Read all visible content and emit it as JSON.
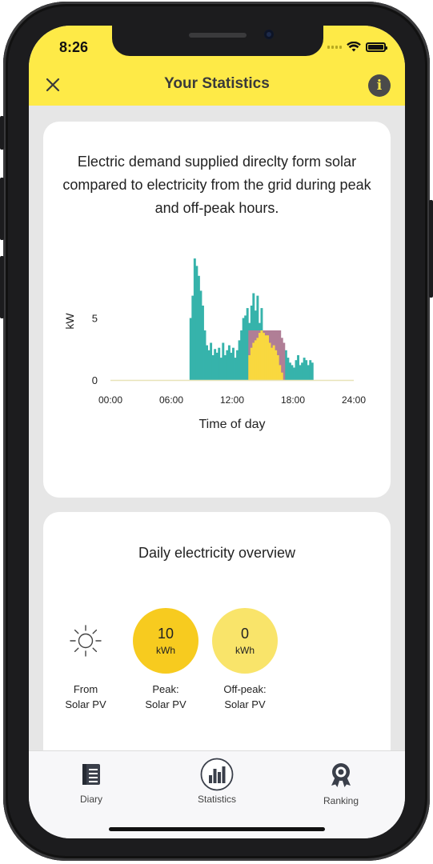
{
  "status_bar": {
    "time": "8:26"
  },
  "header": {
    "title": "Your Statistics",
    "close_icon": "close-icon",
    "info_label": "i"
  },
  "chart_card": {
    "description": "Electric demand supplied direclty form solar compared to electricity from the grid during peak and off-peak hours."
  },
  "chart_data": {
    "type": "area",
    "xlabel": "Time of day",
    "ylabel": "kW",
    "x_ticks": [
      "00:00",
      "06:00",
      "12:00",
      "18:00",
      "24:00"
    ],
    "y_ticks": [
      "0",
      "5"
    ],
    "xlim": [
      0,
      24
    ],
    "ylim": [
      0,
      10
    ],
    "colors": {
      "demand": "#36b3ab",
      "grid": "#b07e96",
      "solar": "#f9d83f",
      "baseline": "#e8e3b8"
    },
    "series": [
      {
        "key": "demand",
        "hours": [
          7.8,
          8.0,
          8.2,
          8.4,
          8.6,
          8.8,
          9.0,
          9.2,
          9.4,
          9.6,
          9.8,
          10.0,
          10.2,
          10.4,
          10.6,
          10.8,
          11.0,
          11.2,
          11.4,
          11.6,
          11.8,
          12.0,
          12.2,
          12.4,
          12.6,
          12.8,
          13.0,
          13.2,
          13.4,
          13.6,
          13.8,
          14.0,
          14.2,
          14.4,
          14.6,
          14.8,
          15.0,
          15.2,
          15.4,
          15.6,
          15.8,
          16.0,
          16.2,
          16.4,
          16.6,
          16.8,
          17.0,
          17.2,
          17.4,
          17.6,
          17.8,
          18.0,
          18.2,
          18.4,
          18.6,
          18.8,
          19.0,
          19.2,
          19.4,
          19.6,
          19.8
        ],
        "values": [
          5.0,
          6.8,
          9.8,
          9.2,
          8.4,
          7.2,
          6.0,
          4.0,
          2.8,
          2.4,
          3.0,
          2.0,
          2.5,
          2.2,
          2.6,
          1.8,
          3.0,
          2.0,
          2.4,
          2.8,
          2.2,
          2.6,
          1.8,
          2.4,
          3.2,
          4.0,
          5.0,
          5.2,
          5.8,
          4.6,
          6.0,
          7.0,
          5.6,
          6.8,
          4.6,
          5.8,
          4.0,
          3.6,
          3.8,
          4.0,
          3.2,
          3.0,
          2.8,
          2.2,
          1.4,
          1.0,
          1.8,
          2.4,
          1.8,
          1.4,
          1.2,
          1.0,
          1.6,
          2.0,
          1.2,
          1.4,
          1.8,
          1.6,
          1.2,
          1.6,
          1.4
        ]
      },
      {
        "key": "grid",
        "hours": [
          13.6,
          13.8,
          14.0,
          14.2,
          14.4,
          14.6,
          14.8,
          15.0,
          15.2,
          15.4,
          15.6,
          15.8,
          16.0,
          16.2,
          16.4,
          16.6,
          16.8,
          17.0
        ],
        "values": [
          4.0,
          4.0,
          4.0,
          4.0,
          4.0,
          4.0,
          4.0,
          4.0,
          4.0,
          4.0,
          4.0,
          4.0,
          4.0,
          4.0,
          4.0,
          4.0,
          3.4,
          3.0
        ]
      },
      {
        "key": "solar",
        "hours": [
          13.6,
          13.8,
          14.0,
          14.2,
          14.4,
          14.6,
          14.8,
          15.0,
          15.2,
          15.4,
          15.6,
          15.8,
          16.0,
          16.2,
          16.4,
          16.6,
          16.8
        ],
        "values": [
          2.0,
          2.6,
          3.0,
          3.2,
          3.4,
          3.8,
          4.0,
          3.8,
          3.6,
          3.6,
          3.0,
          2.6,
          2.8,
          2.4,
          2.0,
          1.2,
          0.6
        ]
      }
    ]
  },
  "overview_card": {
    "title": "Daily electricity overview",
    "metrics": [
      {
        "icon": "sun-icon",
        "caption": "From\nSolar PV"
      },
      {
        "value": "10",
        "unit": "kWh",
        "caption": "Peak:\nSolar PV",
        "color": "#f7cb1f"
      },
      {
        "value": "0",
        "unit": "kWh",
        "caption": "Off-peak:\nSolar PV",
        "color": "#f9e46a"
      }
    ]
  },
  "bottom_nav": {
    "items": [
      {
        "label": "Diary",
        "icon": "diary-icon"
      },
      {
        "label": "Statistics",
        "icon": "statistics-icon"
      },
      {
        "label": "Ranking",
        "icon": "ranking-icon"
      }
    ]
  }
}
